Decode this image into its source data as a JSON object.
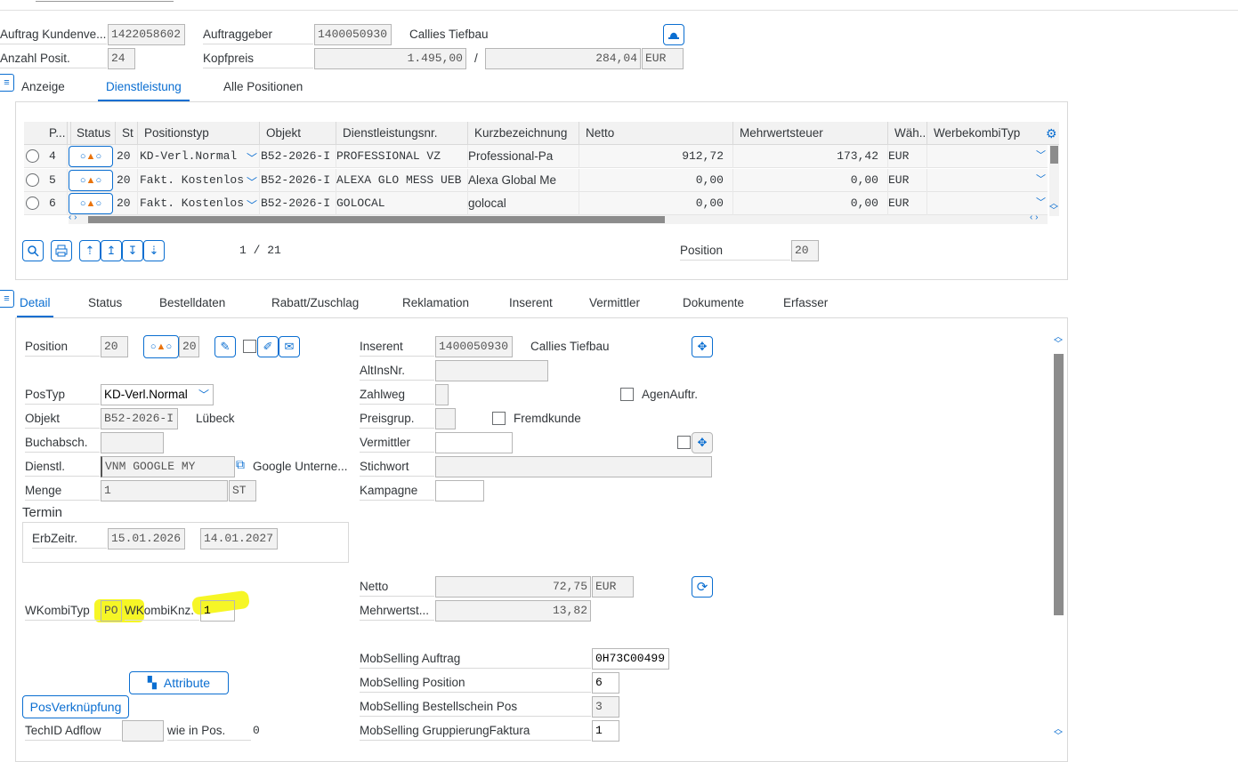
{
  "header": {
    "auftrag_label": "Auftrag Kundenve...",
    "auftrag_value": "1422058602",
    "auftraggeber_label": "Auftraggeber",
    "auftraggeber_value": "1400050930",
    "auftraggeber_name": "Callies Tiefbau",
    "anzahl_label": "Anzahl Posit.",
    "anzahl_value": "24",
    "kopfpreis_label": "Kopfpreis",
    "kopfpreis_value": "1.495,00",
    "slash": "/",
    "kopfpreis_tax": "284,04",
    "currency": "EUR"
  },
  "top_tabs": [
    "Anzeige",
    "Dienstleistung",
    "Alle Positionen"
  ],
  "grid": {
    "columns": [
      "P...",
      "Status",
      "St",
      "Positionstyp",
      "Objekt",
      "Dienstleistungsnr.",
      "Kurzbezeichnung",
      "Netto",
      "Mehrwertsteuer",
      "Wäh...",
      "WerbekombiTyp"
    ],
    "rows": [
      {
        "pos": "4",
        "st": "20",
        "typ": "KD-Verl.Normal",
        "obj": "B52-2026-I",
        "dl": "PROFESSIONAL VZ",
        "kurz": "Professional-Pa",
        "netto": "912,72",
        "mwst": "173,42",
        "cur": "EUR"
      },
      {
        "pos": "5",
        "st": "20",
        "typ": "Fakt. Kostenlos",
        "obj": "B52-2026-I",
        "dl": "ALEXA GLO MESS UEB",
        "kurz": "Alexa Global Me",
        "netto": "0,00",
        "mwst": "0,00",
        "cur": "EUR"
      },
      {
        "pos": "6",
        "st": "20",
        "typ": "Fakt. Kostenlos",
        "obj": "B52-2026-I",
        "dl": "GOLOCAL",
        "kurz": "golocal",
        "netto": "0,00",
        "mwst": "0,00",
        "cur": "EUR"
      }
    ],
    "pager": "1 / 21",
    "position_label": "Position",
    "position_value": "20"
  },
  "detail_tabs": [
    "Detail",
    "Status",
    "Bestelldaten",
    "Rabatt/Zuschlag",
    "Reklamation",
    "Inserent",
    "Vermittler",
    "Dokumente",
    "Erfasser"
  ],
  "detail": {
    "position_label": "Position",
    "position_value": "20",
    "status_value": "20",
    "postyp_label": "PosTyp",
    "postyp_value": "KD-Verl.Normal",
    "objekt_label": "Objekt",
    "objekt_value": "B52-2026-I",
    "objekt_city": "Lübeck",
    "buchabsch_label": "Buchabsch.",
    "dienstl_label": "Dienstl.",
    "dienstl_value": "VNM GOOGLE MY",
    "dienstl_name": "Google Unterne...",
    "menge_label": "Menge",
    "menge_value": "1",
    "menge_unit": "ST",
    "termin_heading": "Termin",
    "erbzeitr_label": "ErbZeitr.",
    "erbzeitr_from": "15.01.2026",
    "erbzeitr_to": "14.01.2027",
    "wkombityp_label": "WKombiTyp",
    "wkombityp_value": "PO",
    "wkombiknz_label": "WKombiKnz.",
    "wkombiknz_value": "1",
    "attribute_button": "Attribute",
    "posverknuepfung_button": "PosVerknüpfung",
    "techid_label": "TechID Adflow",
    "wie_in_pos_label": "wie in Pos.",
    "wie_in_pos_value": "0",
    "inserent_label": "Inserent",
    "inserent_value": "1400050930",
    "inserent_name": "Callies Tiefbau",
    "altinsnr_label": "AltInsNr.",
    "zahlweg_label": "Zahlweg",
    "agenauftr_label": "AgenAuftr.",
    "preisgrup_label": "Preisgrup.",
    "fremdkunde_label": "Fremdkunde",
    "vermittler_label": "Vermittler",
    "stichwort_label": "Stichwort",
    "kampagne_label": "Kampagne",
    "netto_label": "Netto",
    "netto_value": "72,75",
    "netto_currency": "EUR",
    "mwst_label": "Mehrwertst...",
    "mwst_value": "13,82",
    "mob_auftrag_label": "MobSelling Auftrag",
    "mob_auftrag_value": "0H73C00499",
    "mob_position_label": "MobSelling Position",
    "mob_position_value": "6",
    "mob_bestell_label": "MobSelling Bestellschein Pos",
    "mob_bestell_value": "3",
    "mob_grupp_label": "MobSelling GruppierungFaktura",
    "mob_grupp_value": "1"
  },
  "colors": {
    "accent": "#0a6ed1",
    "highlight": "#f4f400",
    "status_triangle": "#e9730c"
  }
}
